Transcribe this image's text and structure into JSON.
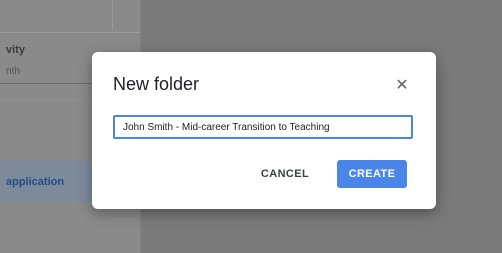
{
  "background": {
    "activity_label": "vity",
    "month_label": "nth",
    "application_label": "application"
  },
  "dialog": {
    "title": "New folder",
    "close_icon": "close-icon",
    "folder_name_value": "John Smith - Mid-career Transition to Teaching",
    "cancel_label": "CANCEL",
    "create_label": "CREATE",
    "accent_color": "#4a86e8"
  }
}
